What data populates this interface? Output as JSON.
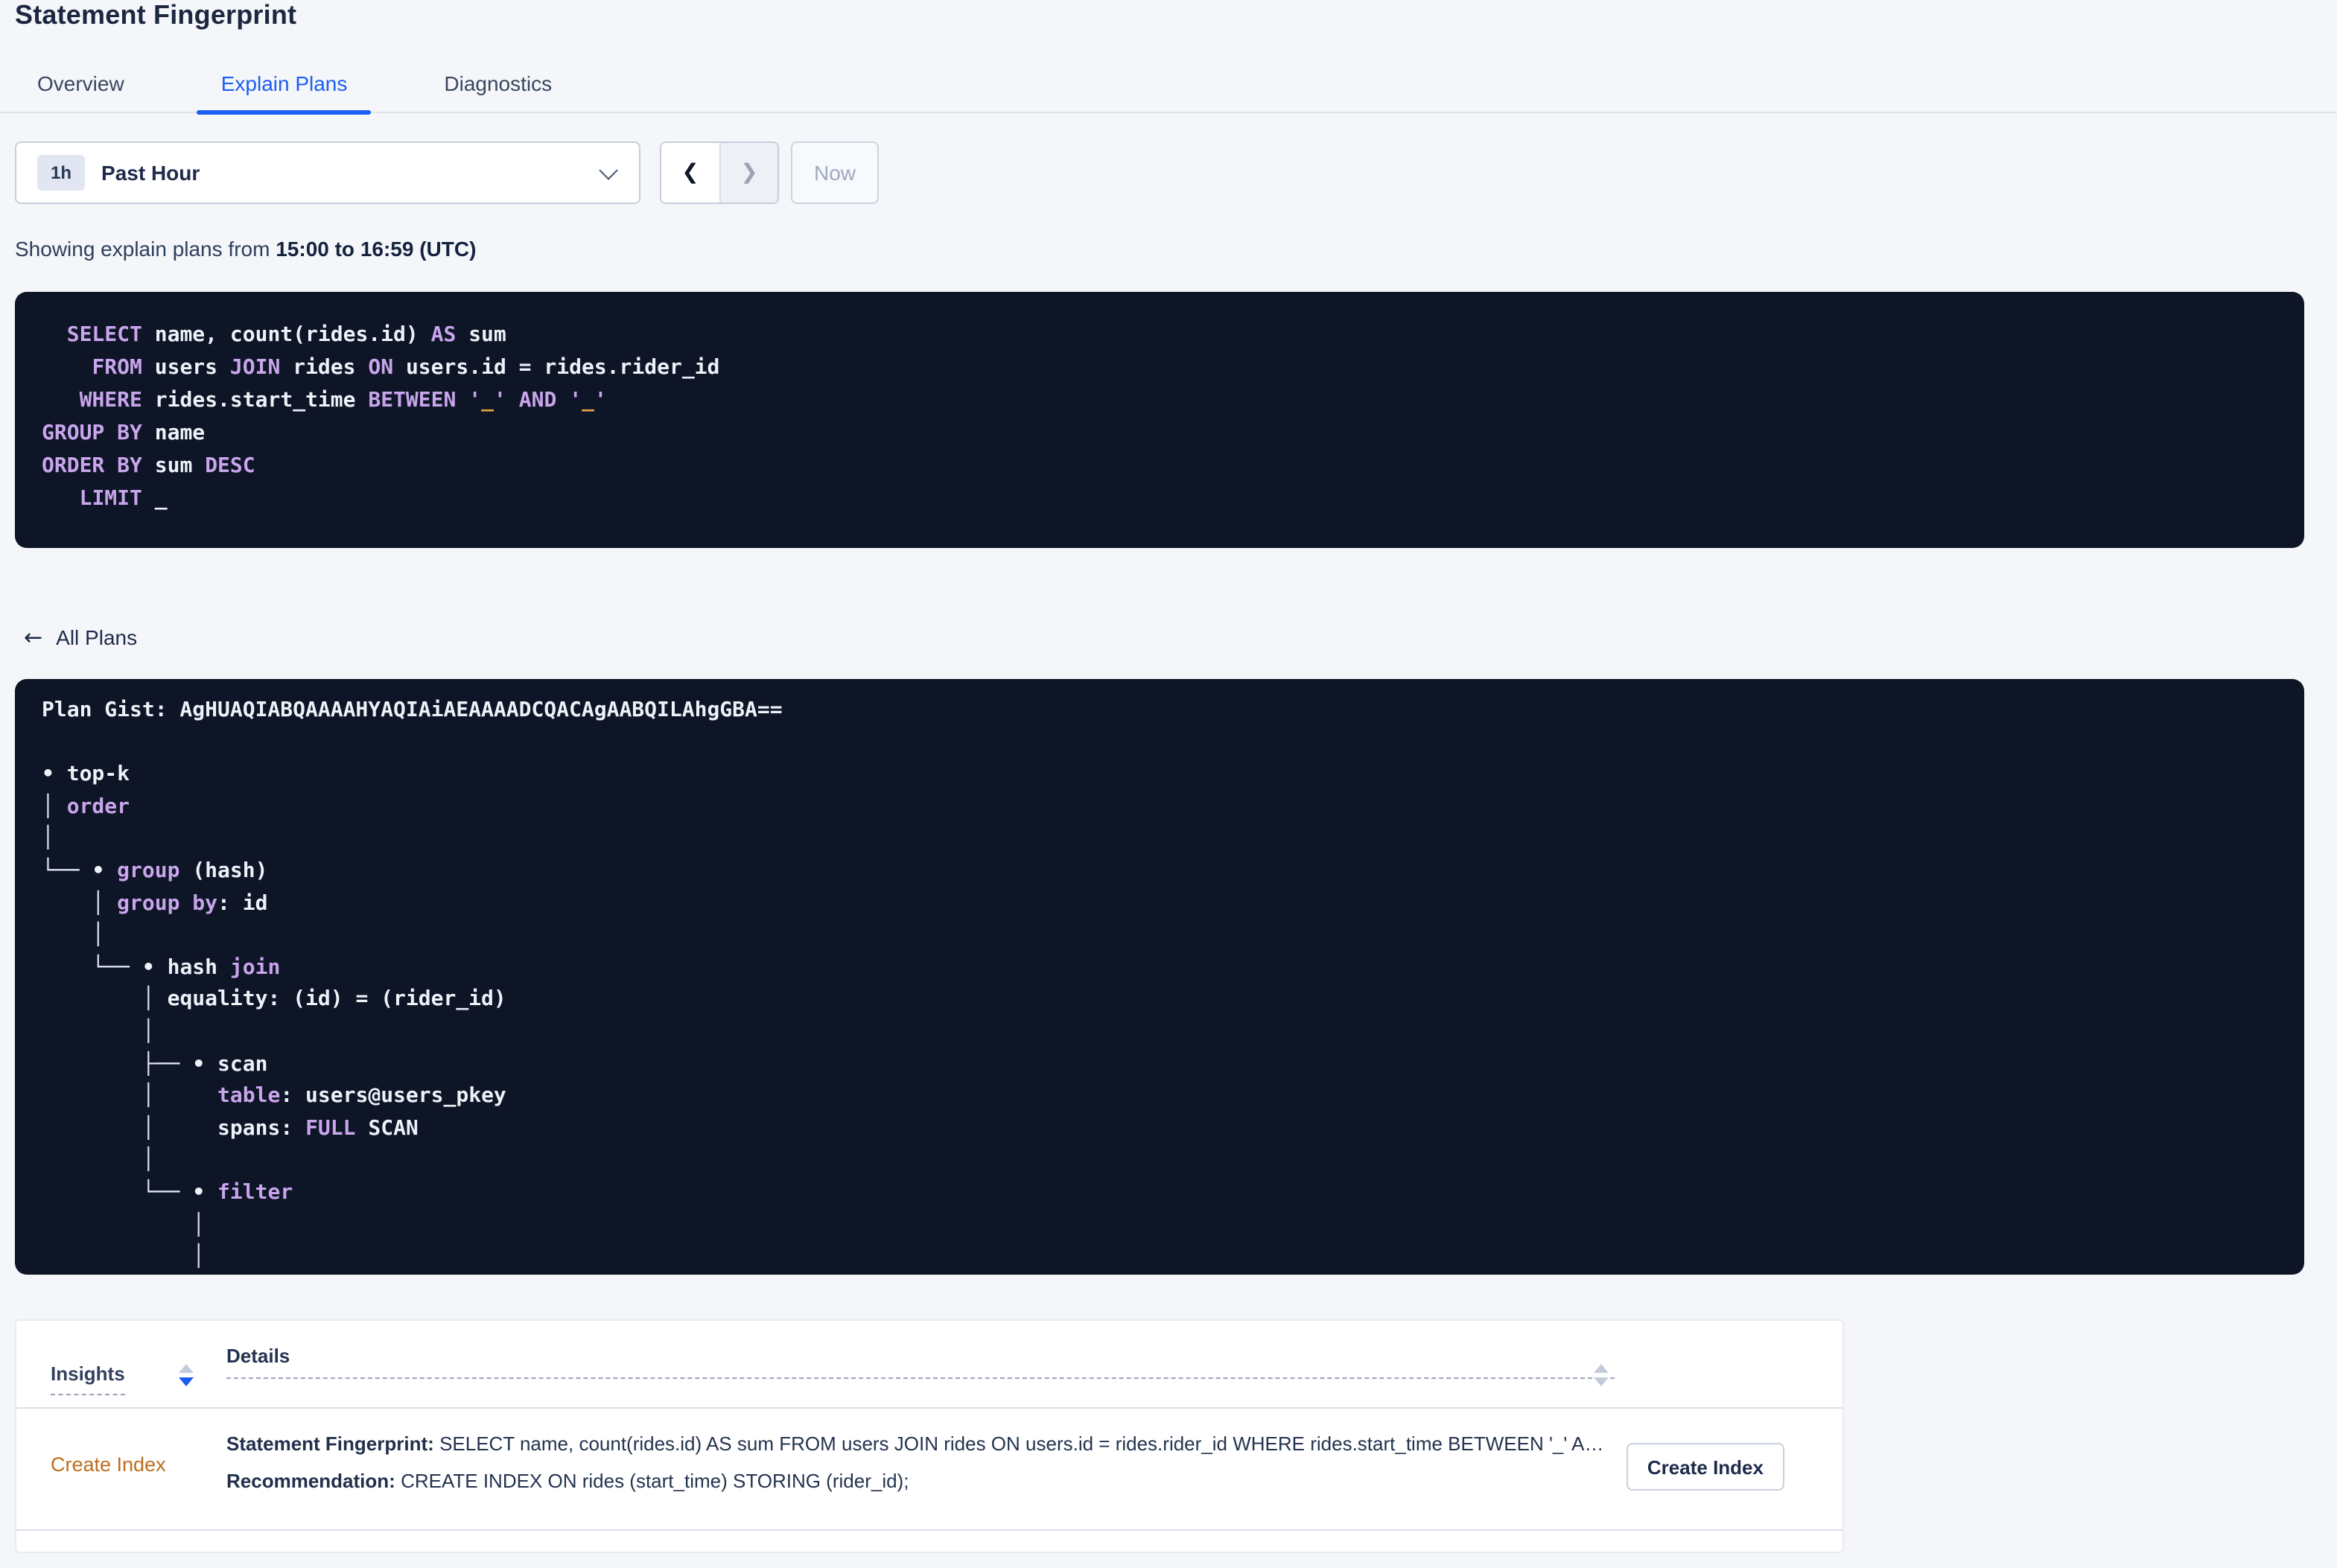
{
  "page": {
    "title": "Statement Fingerprint"
  },
  "tabs": [
    {
      "label": "Overview",
      "active": false
    },
    {
      "label": "Explain Plans",
      "active": true
    },
    {
      "label": "Diagnostics",
      "active": false
    }
  ],
  "time_picker": {
    "badge": "1h",
    "label": "Past Hour",
    "prev_icon": "❮",
    "next_icon": "❯",
    "now_label": "Now"
  },
  "status": {
    "prefix": "Showing explain plans from ",
    "range": "15:00 to 16:59 (UTC)"
  },
  "sql_block": {
    "lines": [
      [
        [
          "w",
          "  "
        ],
        [
          "k",
          "SELECT"
        ],
        [
          "w",
          " name, count(rides.id) "
        ],
        [
          "k",
          "AS"
        ],
        [
          "w",
          " sum"
        ]
      ],
      [
        [
          "w",
          "    "
        ],
        [
          "k",
          "FROM"
        ],
        [
          "w",
          " users "
        ],
        [
          "k",
          "JOIN"
        ],
        [
          "w",
          " rides "
        ],
        [
          "k",
          "ON"
        ],
        [
          "w",
          " users.id = rides.rider_id"
        ]
      ],
      [
        [
          "w",
          "   "
        ],
        [
          "k",
          "WHERE"
        ],
        [
          "w",
          " rides.start_time "
        ],
        [
          "k",
          "BETWEEN"
        ],
        [
          "w",
          " "
        ],
        [
          "k",
          "'"
        ],
        [
          "o",
          "_"
        ],
        [
          "k",
          "'"
        ],
        [
          "w",
          " "
        ],
        [
          "k",
          "AND"
        ],
        [
          "w",
          " "
        ],
        [
          "k",
          "'"
        ],
        [
          "o",
          "_"
        ],
        [
          "k",
          "'"
        ]
      ],
      [
        [
          "k",
          "GROUP BY"
        ],
        [
          "w",
          " name"
        ]
      ],
      [
        [
          "k",
          "ORDER BY"
        ],
        [
          "w",
          " sum "
        ],
        [
          "k",
          "DESC"
        ]
      ],
      [
        [
          "w",
          "   "
        ],
        [
          "k",
          "LIMIT"
        ],
        [
          "w",
          " _"
        ]
      ]
    ]
  },
  "all_plans_link": {
    "arrow": "←",
    "label": "All Plans"
  },
  "plan_block": {
    "gist_label": "Plan Gist:",
    "gist": "AgHUAQIABQAAAAHYAQIAiAEAAAADCQACAgAABQILAhgGBA==",
    "lines": [
      [
        [
          "w",
          "Plan Gist: AgHUAQIABQAAAAHYAQIAiAEAAAADCQACAgAABQILAhgGBA=="
        ]
      ],
      [],
      [
        [
          "w",
          "• top-k"
        ]
      ],
      [
        [
          "t",
          "│ "
        ],
        [
          "k",
          "order"
        ]
      ],
      [
        [
          "t",
          "│"
        ]
      ],
      [
        [
          "t",
          "└── "
        ],
        [
          "w",
          "• "
        ],
        [
          "k",
          "group"
        ],
        [
          "w",
          " (hash)"
        ]
      ],
      [
        [
          "t",
          "    │ "
        ],
        [
          "k",
          "group by"
        ],
        [
          "w",
          ": id"
        ]
      ],
      [
        [
          "t",
          "    │"
        ]
      ],
      [
        [
          "t",
          "    └── "
        ],
        [
          "w",
          "• hash "
        ],
        [
          "k",
          "join"
        ]
      ],
      [
        [
          "t",
          "        │ "
        ],
        [
          "w",
          "equality: (id) = (rider_id)"
        ]
      ],
      [
        [
          "t",
          "        │"
        ]
      ],
      [
        [
          "t",
          "        ├── "
        ],
        [
          "w",
          "• scan"
        ]
      ],
      [
        [
          "t",
          "        │     "
        ],
        [
          "k",
          "table"
        ],
        [
          "w",
          ": users@users_pkey"
        ]
      ],
      [
        [
          "t",
          "        │     "
        ],
        [
          "w",
          "spans: "
        ],
        [
          "k",
          "FULL"
        ],
        [
          "w",
          " SCAN"
        ]
      ],
      [
        [
          "t",
          "        │"
        ]
      ],
      [
        [
          "t",
          "        └── "
        ],
        [
          "w",
          "• "
        ],
        [
          "k",
          "filter"
        ]
      ],
      [
        [
          "t",
          "            │"
        ]
      ],
      [
        [
          "t",
          "            │"
        ]
      ]
    ]
  },
  "insights_table": {
    "columns": [
      {
        "label": "Insights",
        "sort": "desc"
      },
      {
        "label": "Details",
        "sort": "none"
      }
    ],
    "rows": [
      {
        "insight": "Create Index",
        "details_line1_label": "Statement Fingerprint:",
        "details_line1_value": "SELECT name, count(rides.id) AS sum FROM users JOIN rides ON users.id = rides.rider_id WHERE rides.start_time BETWEEN '_' AND '_' GROUP BY name ORDER BY sum DESC LIMIT _",
        "details_line2_label": "Recommendation:",
        "details_line2_value": "CREATE INDEX ON rides (start_time) STORING (rider_id);",
        "action_label": "Create Index"
      }
    ]
  },
  "colors": {
    "page_background": "#f4f6f9",
    "accent_blue": "#1b5df5",
    "code_background": "#0d1526",
    "code_keyword": "#c9a5ec",
    "code_text": "#eef1f8",
    "code_literal_mark": "#e8a43e",
    "insight_link_orange": "#bd6e1e"
  }
}
